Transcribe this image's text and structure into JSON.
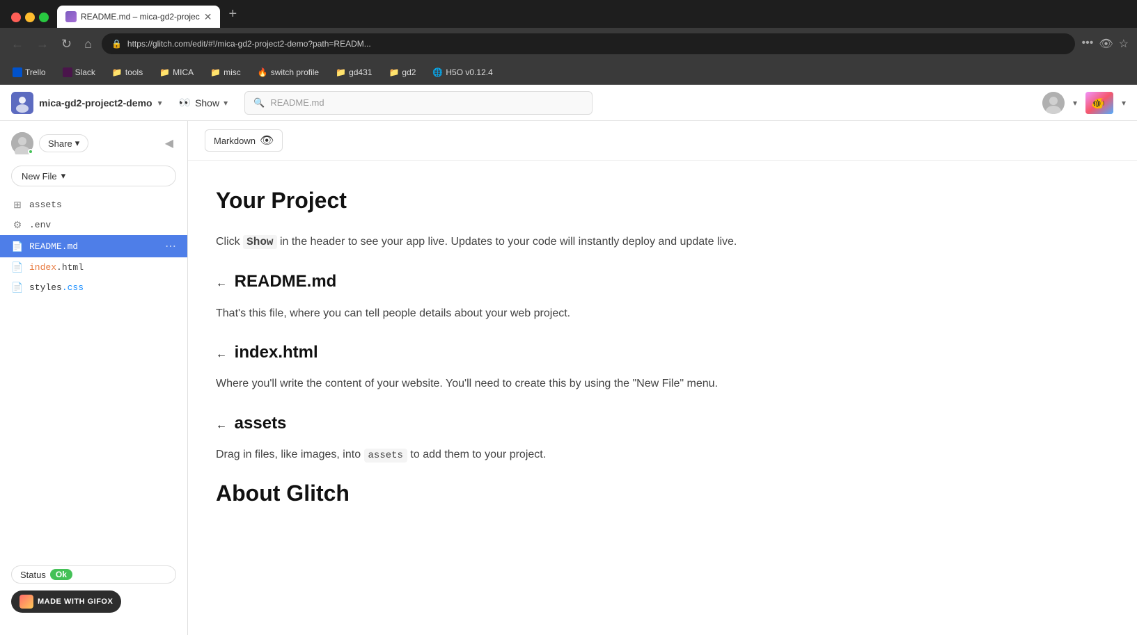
{
  "browser": {
    "tab_title": "README.md – mica-gd2-projec",
    "new_tab_label": "+",
    "address_url": "https://glitch.com/edit/#!/mica-gd2-project2-demo?path=READM...",
    "bookmarks": [
      {
        "id": "trello",
        "label": "Trello",
        "icon": "trello"
      },
      {
        "id": "slack",
        "label": "Slack",
        "icon": "slack"
      },
      {
        "id": "tools",
        "label": "tools",
        "icon": "folder"
      },
      {
        "id": "mica",
        "label": "MICA",
        "icon": "folder"
      },
      {
        "id": "misc",
        "label": "misc",
        "icon": "folder"
      },
      {
        "id": "switch-profile",
        "label": "switch profile",
        "icon": "fire"
      },
      {
        "id": "gd431",
        "label": "gd431",
        "icon": "folder"
      },
      {
        "id": "gd2",
        "label": "gd2",
        "icon": "folder"
      },
      {
        "id": "h5o",
        "label": "H5O v0.12.4",
        "icon": "globe"
      }
    ]
  },
  "app_header": {
    "project_name": "mica-gd2-project2-demo",
    "show_label": "Show",
    "file_search_placeholder": "README.md",
    "user_dropdown_label": "▾",
    "fish_dropdown_label": "▾"
  },
  "sidebar": {
    "share_label": "Share",
    "share_dropdown": "▾",
    "new_file_label": "New File",
    "new_file_dropdown": "▾",
    "files": [
      {
        "id": "assets",
        "name": "assets",
        "icon": "📦",
        "type": "folder",
        "active": false
      },
      {
        "id": "env",
        "name": ".env",
        "icon": "🔑",
        "type": "env",
        "active": false
      },
      {
        "id": "readme",
        "name": "README.md",
        "icon": "📄",
        "type": "md",
        "active": true
      },
      {
        "id": "index-html",
        "name": "index.html",
        "icon": "📄",
        "type": "html",
        "active": false
      },
      {
        "id": "styles-css",
        "name": "styles.css",
        "icon": "📄",
        "type": "css",
        "active": false
      }
    ],
    "status_label": "Status",
    "status_value": "Ok",
    "made_with": "MADE WITH GIFOX"
  },
  "content": {
    "toolbar_badge": "Markdown",
    "heading1": "Your Project",
    "p1_before_show": "Click ",
    "p1_show": "Show",
    "p1_after": " in the header to see your app live. Updates to your code will instantly deploy and update live.",
    "heading2_readme": "README.md",
    "p2": "That's this file, where you can tell people details about your web project.",
    "heading2_index": "index.html",
    "p3": "Where you'll write the content of your website. You'll need to create this by using the \"New File\" menu.",
    "heading2_assets": "assets",
    "p4_before": "Drag in files, like images, into ",
    "p4_code": "assets",
    "p4_after": " to add them to your project.",
    "heading3_about": "About Glitch"
  }
}
